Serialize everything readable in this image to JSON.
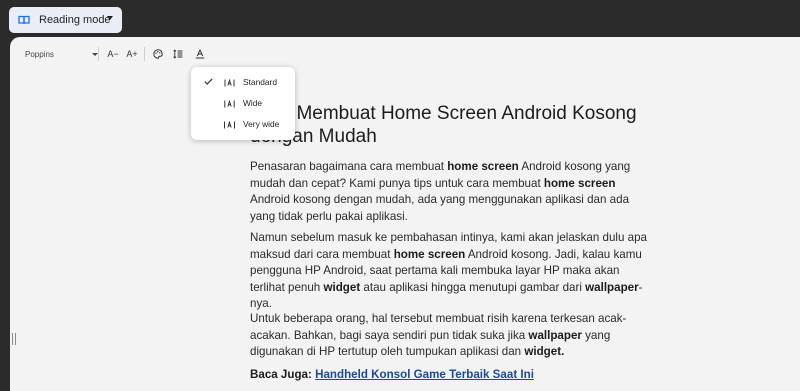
{
  "reading_mode": {
    "label": "Reading mode"
  },
  "toolbar": {
    "font": "Poppins",
    "decrease_font_label": "A−",
    "increase_font_label": "A+",
    "icons": [
      "palette-icon",
      "line-spacing-icon",
      "letter-spacing-icon"
    ]
  },
  "letter_spacing_menu": {
    "selected": "Standard",
    "items": [
      {
        "label": "Standard"
      },
      {
        "label": "Wide"
      },
      {
        "label": "Very wide"
      }
    ]
  },
  "article": {
    "title": "Cara Membuat Home Screen Android Kosong dengan Mudah",
    "p1": {
      "a": "Penasaran bagaimana cara membuat ",
      "b": "home screen",
      "c": " Android kosong yang mudah dan cepat? Kami punya tips untuk cara membuat ",
      "d": "home screen",
      "e": " Android kosong dengan mudah, ada yang menggunakan aplikasi dan ada yang tidak perlu pakai aplikasi."
    },
    "p2": {
      "a": "Namun sebelum masuk ke pembahasan intinya, kami akan jelaskan dulu apa maksud dari cara membuat ",
      "b": "home screen",
      "c": " Android kosong. Jadi, kalau kamu pengguna HP Android, saat pertama kali membuka layar HP maka akan terlihat penuh ",
      "d": "widget",
      "e": " atau aplikasi hingga menutupi gambar dari ",
      "f": "wallpaper",
      "g": "-nya."
    },
    "p3": {
      "a": "Untuk beberapa orang, hal tersebut membuat risih karena terkesan acak-acakan. Bahkan, bagi saya sendiri pun tidak suka jika ",
      "b": "wallpaper",
      "c": " yang digunakan di HP tertutup oleh tumpukan aplikasi dan ",
      "d": "widget."
    },
    "related": {
      "prefix": "Baca Juga: ",
      "link": "Handheld Konsol Game Terbaik Saat Ini"
    }
  },
  "colors": {
    "chrome_bg": "#2b2b2b",
    "panel_bg": "#f3f3f3",
    "chip_bg": "#e9eef6",
    "accent_blue": "#1a73e8",
    "link": "#1a4a9c"
  }
}
